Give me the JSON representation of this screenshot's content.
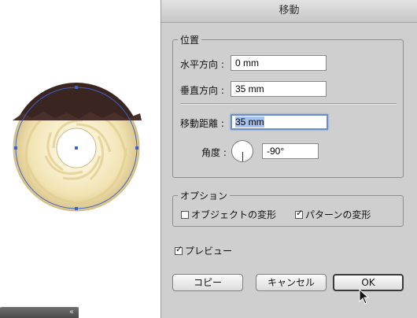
{
  "dialog": {
    "title": "移動",
    "position_group": {
      "legend": "位置",
      "horizontal_label": "水平方向 :",
      "horizontal_value": "0 mm",
      "vertical_label": "垂直方向 :",
      "vertical_value": "35 mm",
      "distance_label": "移動距離 :",
      "distance_value": "35 mm",
      "angle_label": "角度 :",
      "angle_value": "-90°"
    },
    "options_group": {
      "legend": "オプション",
      "transform_objects": {
        "label": "オブジェクトの変形",
        "checked": false
      },
      "transform_patterns": {
        "label": "パターンの変形",
        "checked": true
      }
    },
    "preview": {
      "label": "プレビュー",
      "checked": true
    },
    "buttons": {
      "copy": "コピー",
      "cancel": "キャンセル",
      "ok": "OK"
    }
  },
  "colors": {
    "dialog_bg": "#cfcfcf",
    "selection_blue": "#a7c1f0",
    "bounding_path": "#3c64c8",
    "chocolate": "#3a2520",
    "cookie": "#f3e6b8"
  },
  "icons": {
    "check": "check-icon",
    "cursor": "mouse-pointer-icon",
    "collapse": "double-chevron-left-icon"
  }
}
